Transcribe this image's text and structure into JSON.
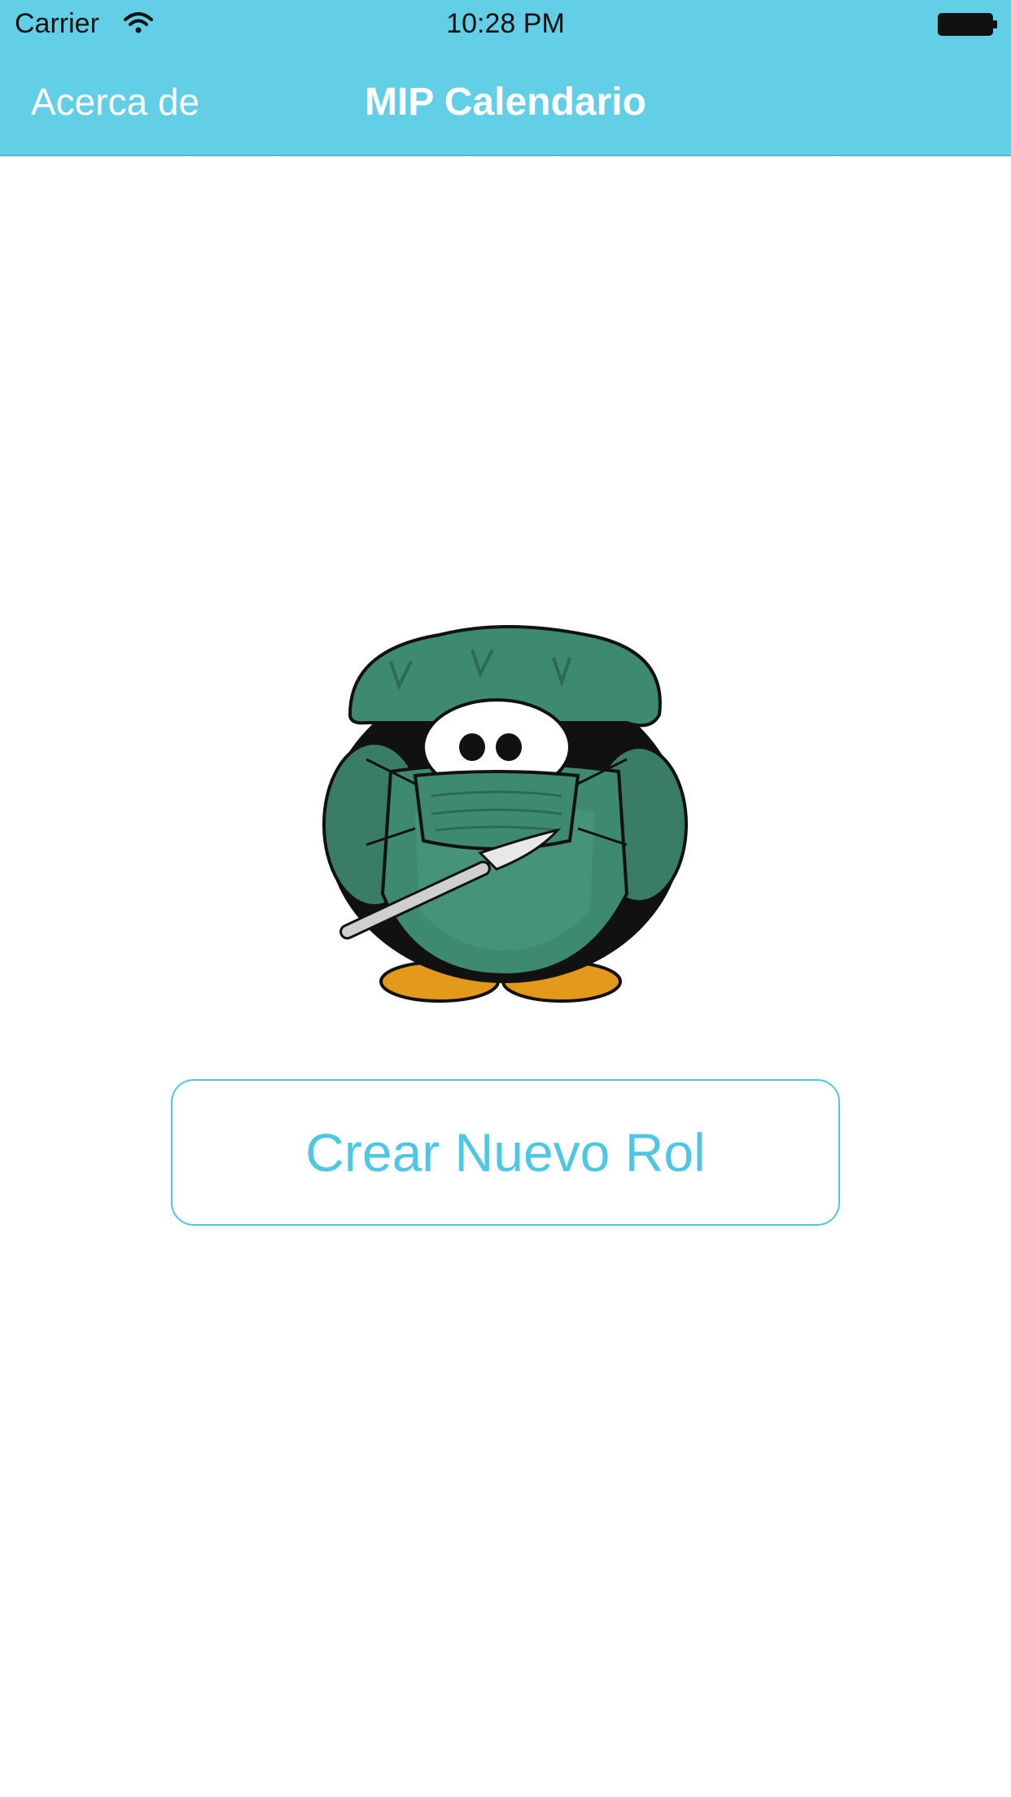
{
  "status_bar": {
    "carrier": "Carrier",
    "time": "10:28 PM",
    "wifi_icon": "wifi-icon",
    "battery_icon": "battery-icon"
  },
  "nav_bar": {
    "back_label": "Acerca de",
    "title": "MIP Calendario"
  },
  "main": {
    "mascot_icon": "surgeon-penguin-illustration",
    "create_button_label": "Crear Nuevo Rol"
  },
  "colors": {
    "accent": "#63cfe6",
    "button_text": "#4fc7e4",
    "scrubs_green": "#3a7d66",
    "beak_orange": "#e39a1c"
  }
}
